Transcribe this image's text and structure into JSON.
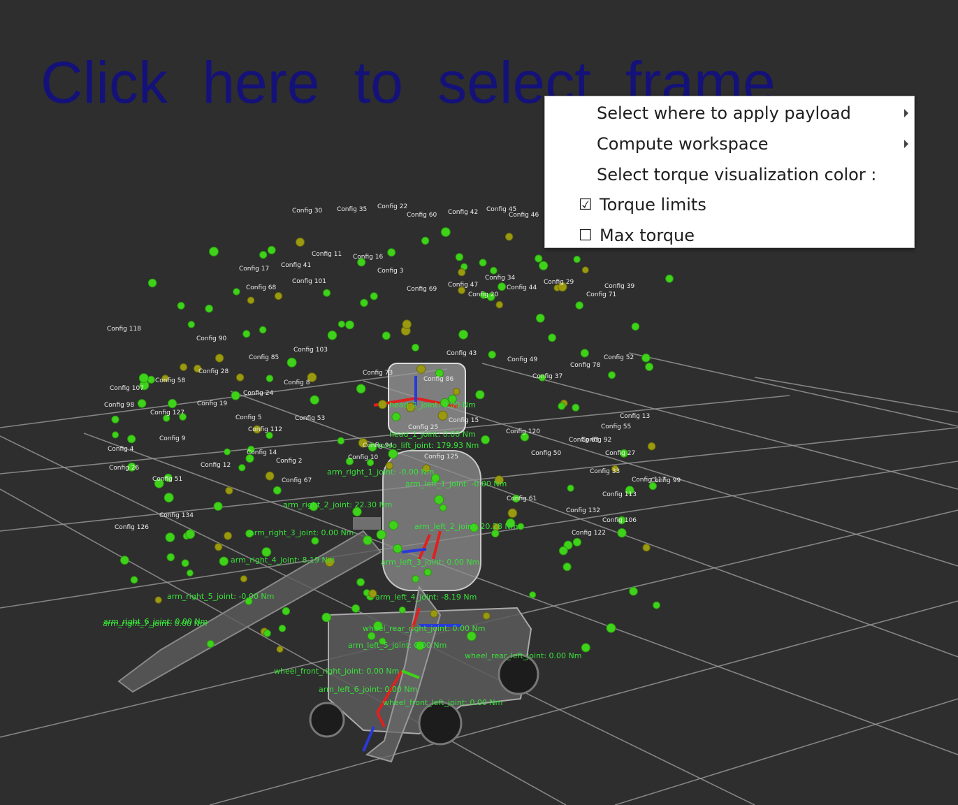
{
  "viewport": {
    "frame_prompt": "Click here to select frame",
    "background_color": "#2e2e2e",
    "grid_color": "#9a9a9a",
    "sphere_colors": {
      "green": "#3fd21a",
      "olive": "#9a9a10"
    }
  },
  "context_menu": {
    "items": [
      {
        "label": "Select where to apply payload",
        "submenu": true
      },
      {
        "label": "Compute workspace",
        "submenu": true
      },
      {
        "label": "Select torque visualization color :",
        "submenu": false
      },
      {
        "label": "Torque limits",
        "checkbox": true,
        "checked": true,
        "check_glyph": "☑"
      },
      {
        "label": "Max torque",
        "checkbox": true,
        "checked": false,
        "check_glyph": "☐"
      }
    ]
  },
  "joint_labels": [
    "head_2_joint: 0.00 Nm",
    "head_1_joint: 0.00 Nm",
    "torso_lift_joint: 179.93 Nm",
    "arm_right_1_joint: -0.00 Nm",
    "arm_left_1_joint: -0.00 Nm",
    "arm_right_2_joint: 22.30 Nm",
    "arm_left_2_joint: 20.28 Nm",
    "arm_right_3_joint: 0.00 Nm",
    "arm_right_4_joint: 8.19 Nm",
    "arm_left_3_joint: 0.00 Nm",
    "arm_right_5_joint: -0.00 Nm",
    "arm_left_4_joint: -8.19 Nm",
    "arm_right_7_joint: 0.00 Nm",
    "arm_right_6_joint: 0.00 Nm",
    "arm_left_5_joint: 0.00 Nm",
    "wheel_rear_right_joint: 0.00 Nm",
    "wheel_rear_left_joint: 0.00 Nm",
    "wheel_front_right_joint: 0.00 Nm",
    "arm_left_6_joint: 0.00 Nm",
    "wheel_front_left_joint: 0.00 Nm"
  ],
  "config_labels": [
    "Config 30",
    "Config 35",
    "Config 22",
    "Config 60",
    "Config 42",
    "Config 45",
    "Config 46",
    "Config 11",
    "Config 16",
    "Config 17",
    "Config 41",
    "Config 101",
    "Config 3",
    "Config 69",
    "Config 47",
    "Config 34",
    "Config 29",
    "Config 44",
    "Config 71",
    "Config 20",
    "Config 39",
    "Config 68",
    "Config 118",
    "Config 90",
    "Config 103",
    "Config 85",
    "Config 43",
    "Config 49",
    "Config 52",
    "Config 73",
    "Config 86",
    "Config 78",
    "Config 37",
    "Config 58",
    "Config 24",
    "Config 107",
    "Config 98",
    "Config 127",
    "Config 53",
    "Config 112",
    "Config 92",
    "Config 55",
    "Config 28",
    "Config 13",
    "Config 19",
    "Config 8",
    "Config 5",
    "Config 15",
    "Config 25",
    "Config 120",
    "Config 94",
    "Config 125",
    "Config 50",
    "Config 63",
    "Config 9",
    "Config 4",
    "Config 26",
    "Config 51",
    "Config 12",
    "Config 14",
    "Config 2",
    "Config 10",
    "Config 67",
    "Config 33",
    "Config 61",
    "Config 132",
    "Config 106",
    "Config 122",
    "Config 117",
    "Config 113",
    "Config 27",
    "Config 99",
    "Config 126",
    "Config 134"
  ]
}
